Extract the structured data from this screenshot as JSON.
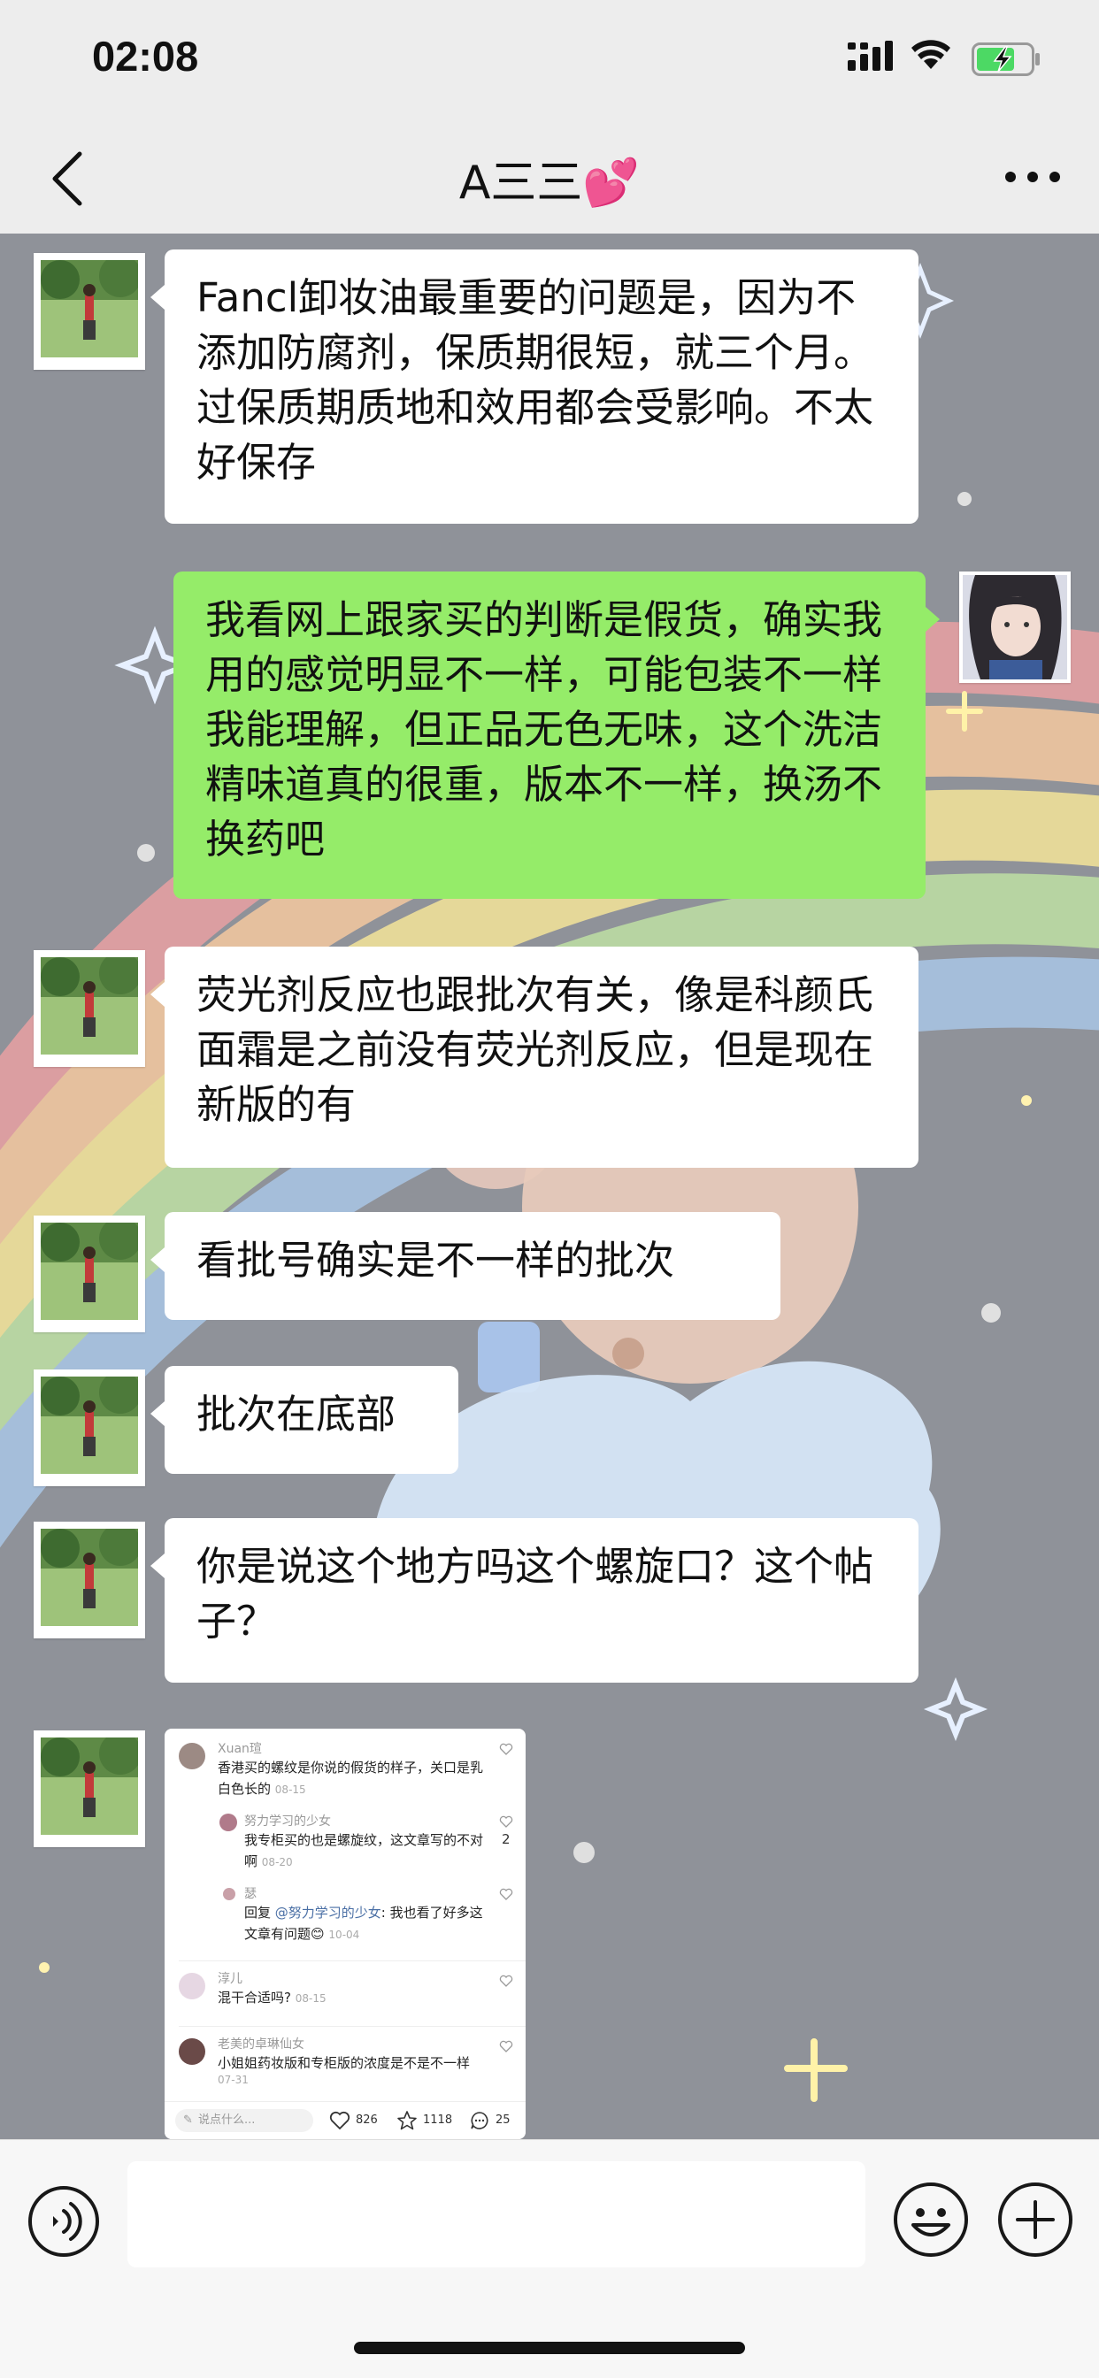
{
  "status_bar": {
    "time": "02:08"
  },
  "nav": {
    "title": "A三三💕",
    "back_icon": "chevron-left-icon",
    "more_icon": "more-dots-icon"
  },
  "colors": {
    "outgoing_bubble": "#95ec69",
    "incoming_bubble": "#ffffff",
    "chat_background": "#8f9299",
    "battery_charge": "#4cd964"
  },
  "messages": [
    {
      "side": "in",
      "text": "Fancl卸妆油最重要的问题是，因为不添加防腐剂，保质期很短，就三个月。过保质期质地和效用都会受影响。不太好保存"
    },
    {
      "side": "out",
      "text": "我看网上跟家买的判断是假货，确实我用的感觉明显不一样，可能包装不一样我能理解，但正品无色无味，这个洗洁精味道真的很重，版本不一样，换汤不换药吧"
    },
    {
      "side": "in",
      "text": "荧光剂反应也跟批次有关，像是科颜氏面霜是之前没有荧光剂反应，但是现在新版的有"
    },
    {
      "side": "in",
      "text": "看批号确实是不一样的批次"
    },
    {
      "side": "in",
      "text": "批次在底部"
    },
    {
      "side": "in",
      "text": "你是说这个地方吗这个螺旋口？这个帖子？"
    }
  ],
  "image_message": {
    "comments": [
      {
        "name": "Xuan瑄",
        "text": "香港买的螺纹是你说的假货的样子，关口是乳白色长的",
        "date": "08-15"
      },
      {
        "name": "努力学习的少女",
        "text": "我专柜买的也是螺旋纹，这文章写的不对啊",
        "date": "08-20",
        "likes": "2"
      },
      {
        "name": "瑟",
        "text_prefix": "回复 ",
        "mention": "@努力学习的少女",
        "text": ": 我也看了好多这文章有问题😊",
        "date": "10-04"
      },
      {
        "name": "淳儿",
        "text": "混干合适吗?",
        "date": "08-15"
      },
      {
        "name": "老美的卓琳仙女",
        "text": "小姐姐药妆版和专柜版的浓度是不是不一样",
        "date": "07-31"
      }
    ],
    "footer": {
      "placeholder": "说点什么...",
      "likes": "826",
      "stars": "1118",
      "comments": "25"
    }
  },
  "input_bar": {
    "placeholder": ""
  }
}
